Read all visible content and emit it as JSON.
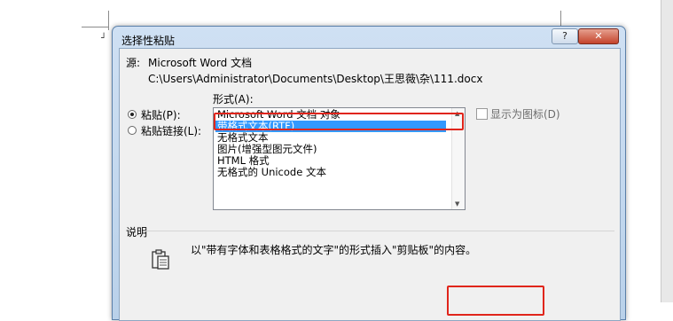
{
  "dialog": {
    "title": "选择性粘贴",
    "help_label": "?",
    "close_label": "✕",
    "source_label": "源:",
    "source_app": "Microsoft Word 文档",
    "source_path": "C:\\Users\\Administrator\\Documents\\Desktop\\王思薇\\杂\\111.docx",
    "format_label": "形式(A):",
    "paste_label": "粘贴(P):",
    "paste_link_label": "粘贴链接(L):",
    "selected_option": "paste",
    "formats": [
      "Microsoft Word 文档 对象",
      "带格式文本(RTF)",
      "无格式文本",
      "图片(增强型图元文件)",
      "HTML 格式",
      "无格式的 Unicode 文本"
    ],
    "selected_format_index": 1,
    "display_as_icon_label": "显示为图标(D)",
    "display_as_icon_checked": false,
    "description_heading": "说明",
    "description_text": "以\"带有字体和表格格式的文字\"的形式插入\"剪贴板\"的内容。",
    "icons": {
      "clipboard": "clipboard-icon",
      "scroll_up": "scroll-up-icon",
      "scroll_down": "scroll-down-icon"
    },
    "highlight_color": "#e0251b",
    "selection_color": "#3399ff"
  }
}
